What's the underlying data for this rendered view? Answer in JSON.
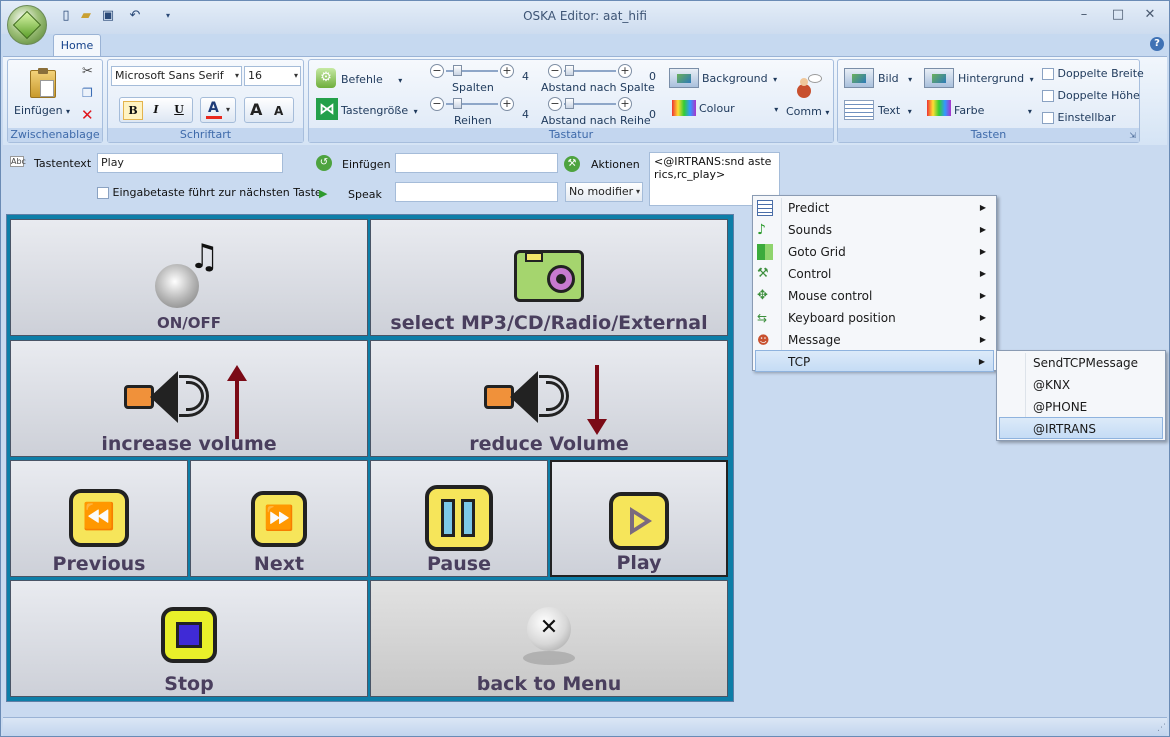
{
  "window": {
    "title": "OSKA Editor: aat_hifi"
  },
  "ribbon": {
    "tab": "Home",
    "clipboard": {
      "label": "Zwischenablage",
      "paste": "Einfügen"
    },
    "font": {
      "label": "Schriftart",
      "family": "Microsoft Sans Serif",
      "size": "16",
      "bold": "B",
      "italic": "I",
      "underline": "U",
      "color": "A"
    },
    "keyboard": {
      "label": "Tastatur",
      "commands": "Befehle",
      "keysize": "Tastengröße",
      "columns_label": "Spalten",
      "columns_value": "4",
      "rows_label": "Reihen",
      "rows_value": "4",
      "colspace_label": "Abstand nach Spalte",
      "colspace_value": "0",
      "rowspace_label": "Abstand nach Reihe",
      "rowspace_value": "0",
      "background": "Background",
      "colour": "Colour",
      "comm": "Comm"
    },
    "keys": {
      "label": "Tasten",
      "image": "Bild",
      "text": "Text",
      "bg": "Hintergrund",
      "color": "Farbe",
      "double_width": "Doppelte Breite",
      "double_height": "Doppelte Höhe",
      "adjustable": "Einstellbar"
    }
  },
  "props": {
    "keytext_label": "Tastentext",
    "keytext_value": "Play",
    "enter_next_label": "Eingabetaste führt zur nächsten Taste",
    "insert_label": "Einfügen",
    "insert_value": "",
    "speak_label": "Speak",
    "speak_value": "",
    "modifier": "No modifier",
    "actions_label": "Aktionen",
    "actions_value": "<@IRTRANS:snd asterics,rc_play>"
  },
  "keys": [
    {
      "label": "ON/OFF"
    },
    {
      "label": "select MP3/CD/Radio/External"
    },
    {
      "label": "increase volume"
    },
    {
      "label": "reduce Volume"
    },
    {
      "label": "Previous"
    },
    {
      "label": "Next"
    },
    {
      "label": "Pause"
    },
    {
      "label": "Play"
    },
    {
      "label": "Stop"
    },
    {
      "label": "back to Menu"
    }
  ],
  "context_menu": {
    "items": [
      {
        "label": "Predict"
      },
      {
        "label": "Sounds"
      },
      {
        "label": "Goto Grid"
      },
      {
        "label": "Control"
      },
      {
        "label": "Mouse control"
      },
      {
        "label": "Keyboard position"
      },
      {
        "label": "Message"
      },
      {
        "label": "TCP"
      }
    ],
    "submenu": [
      {
        "label": "SendTCPMessage"
      },
      {
        "label": "@KNX"
      },
      {
        "label": "@PHONE"
      },
      {
        "label": "@IRTRANS"
      }
    ]
  }
}
